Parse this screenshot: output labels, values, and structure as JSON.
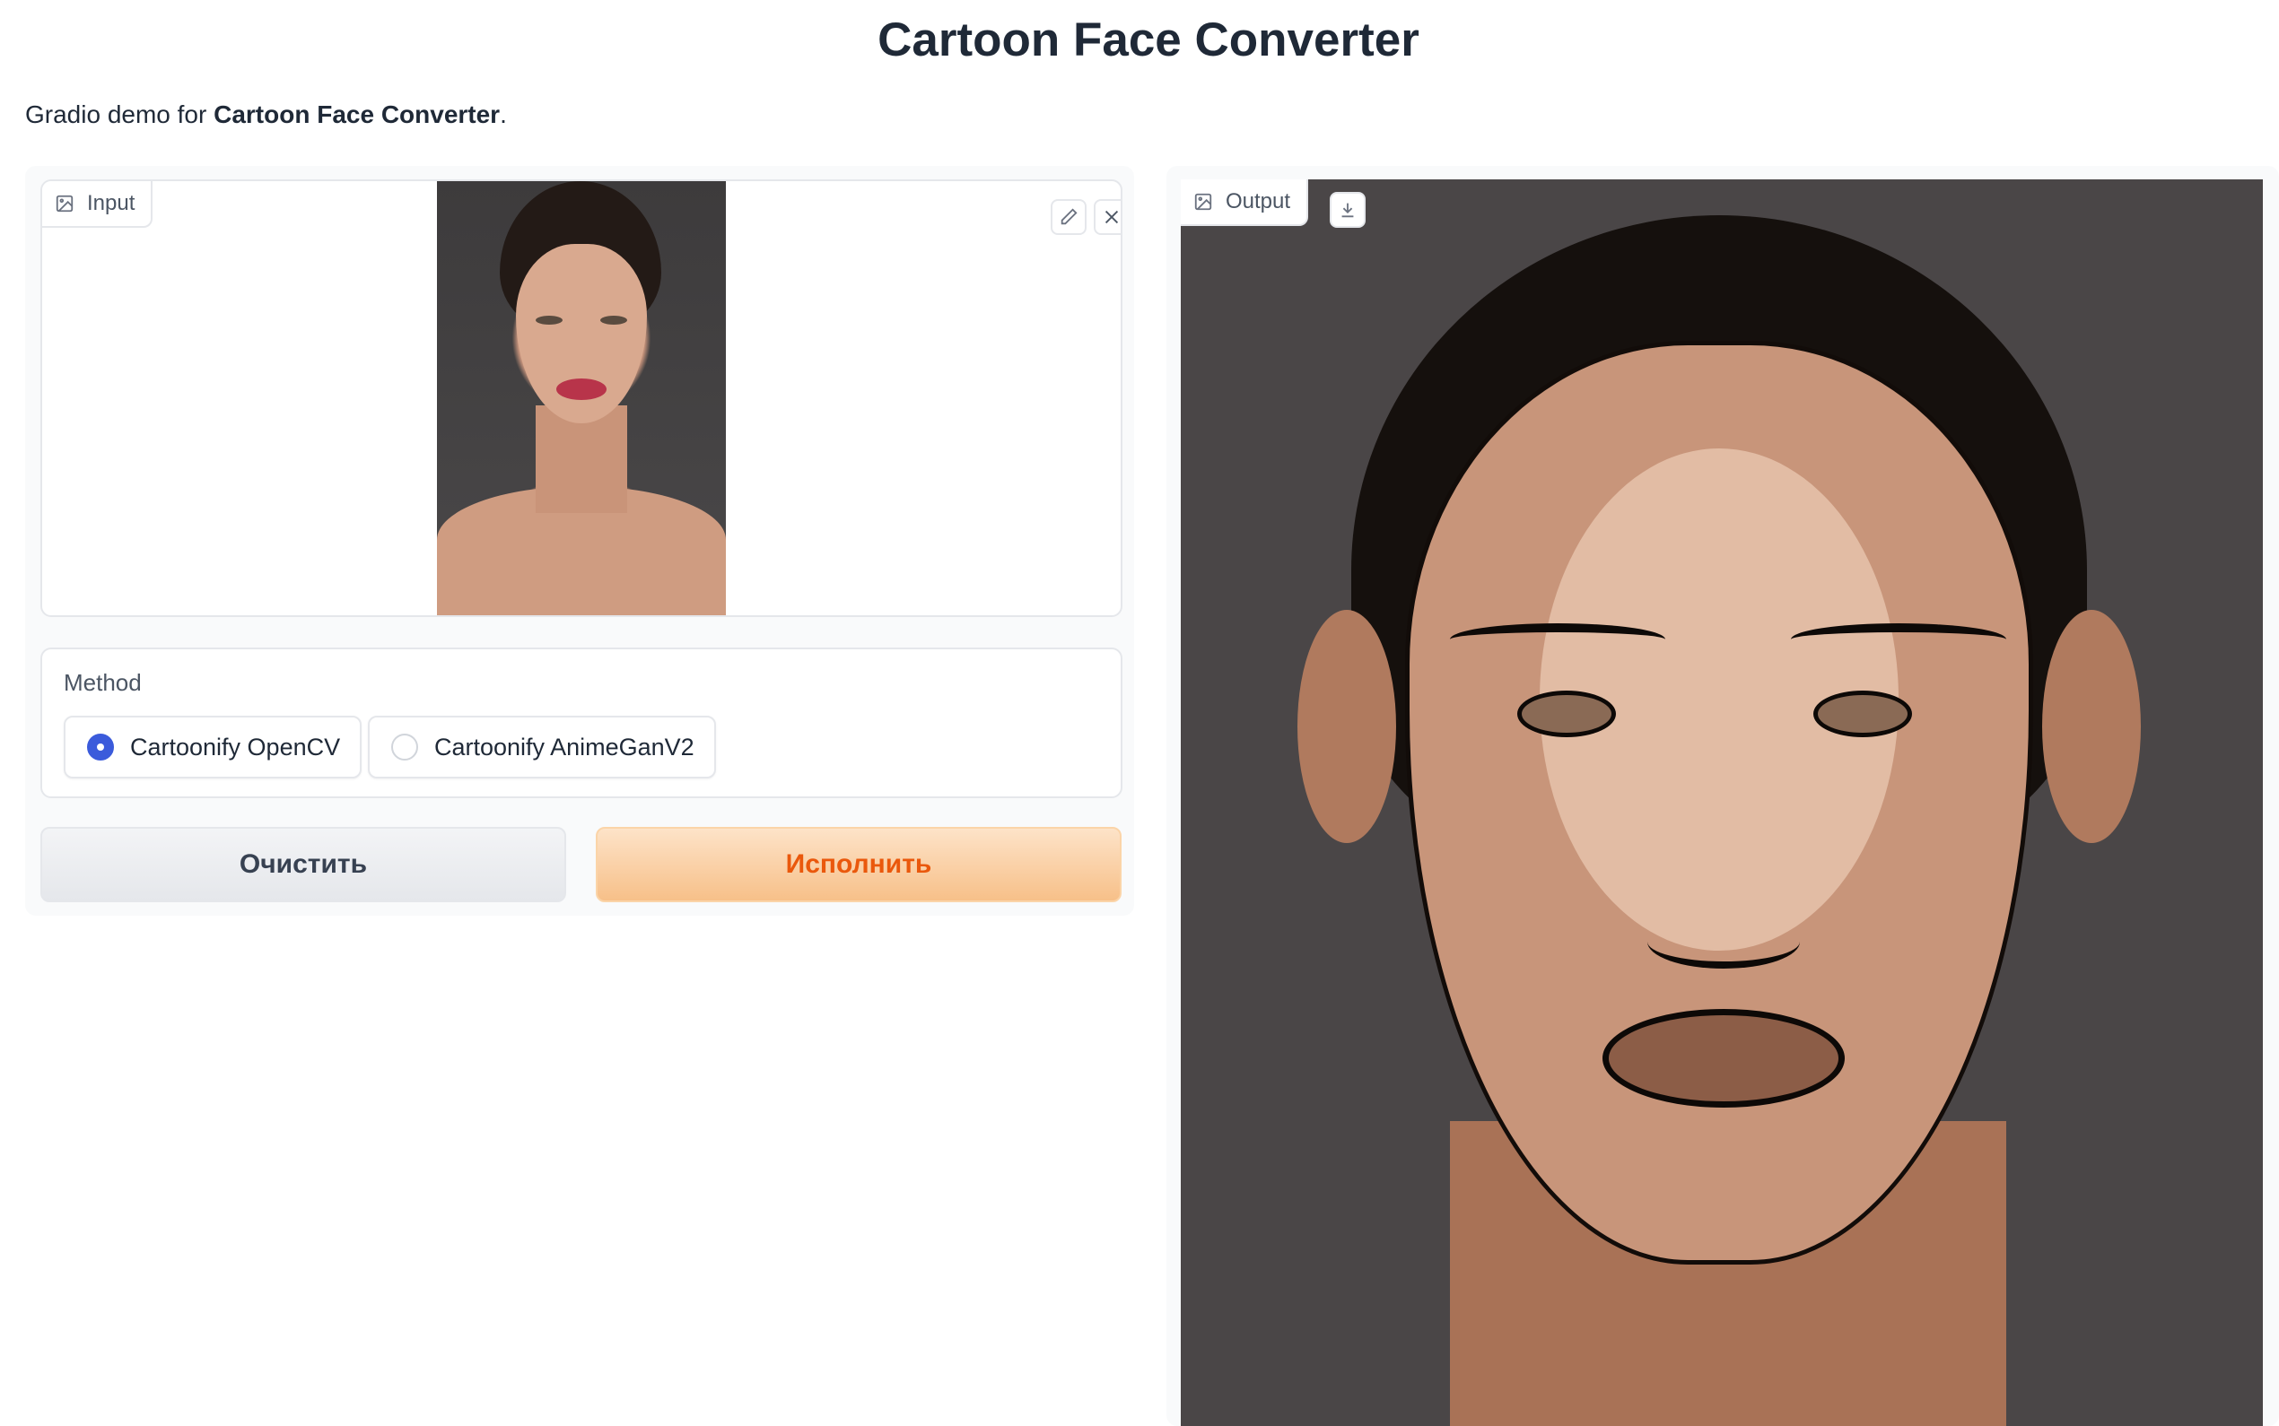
{
  "header": {
    "title": "Cartoon Face Converter",
    "desc_prefix": "Gradio demo for ",
    "desc_bold": "Cartoon Face Converter",
    "desc_suffix": "."
  },
  "input": {
    "label": "Input",
    "icon": "image-icon",
    "tools": [
      "edit-icon",
      "close-icon"
    ]
  },
  "method": {
    "label": "Method",
    "options": [
      "Cartoonify OpenCV",
      "Cartoonify AnimeGanV2"
    ],
    "selected": "Cartoonify OpenCV"
  },
  "buttons": {
    "clear": "Очистить",
    "submit": "Исполнить"
  },
  "output": {
    "label": "Output",
    "icon": "image-icon",
    "tools": [
      "download-icon"
    ]
  },
  "colors": {
    "accent": "#ea580c",
    "radio_selected": "#3b5bdb"
  }
}
